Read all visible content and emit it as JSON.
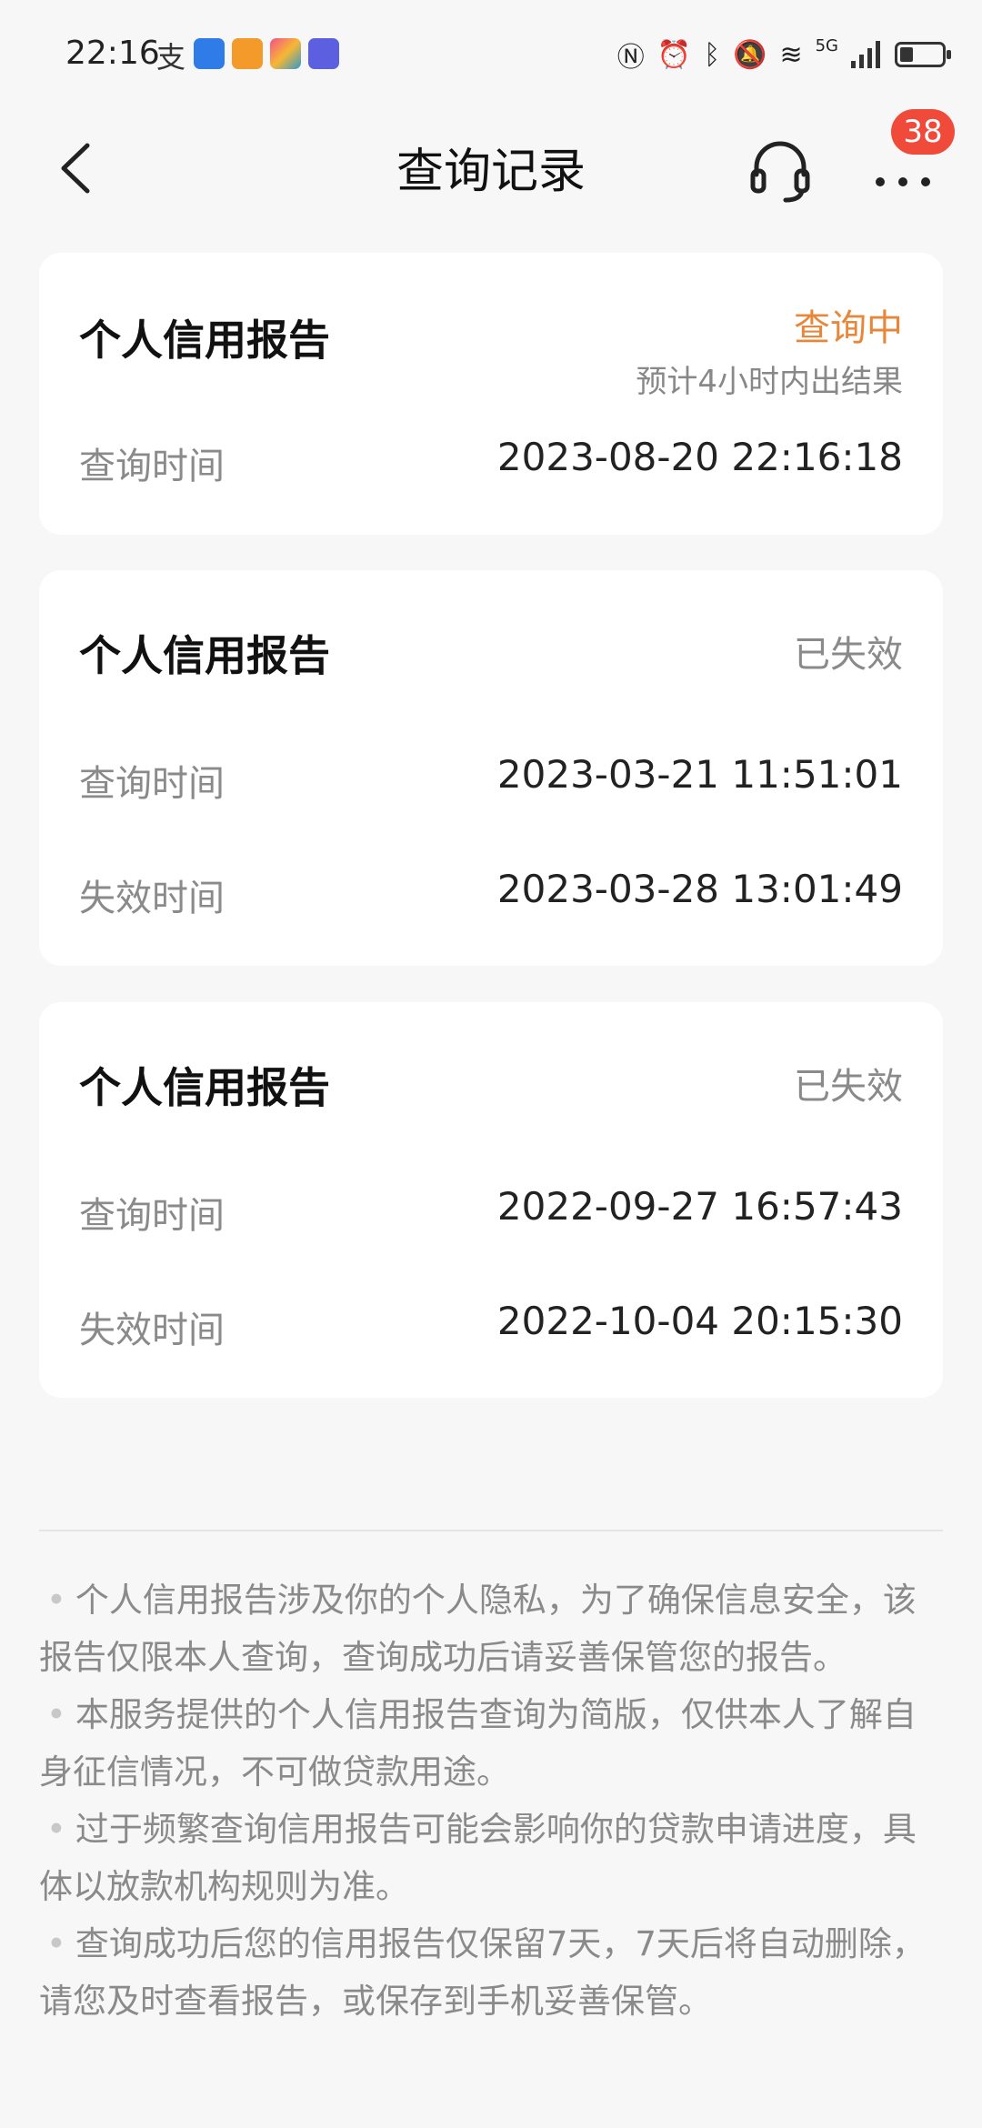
{
  "status_bar": {
    "time": "22:16",
    "network": "5G"
  },
  "nav": {
    "title": "查询记录",
    "badge_count": "38",
    "icons": [
      "back-icon",
      "headset-icon",
      "more-icon"
    ]
  },
  "records": [
    {
      "title": "个人信用报告",
      "status": "查询中",
      "status_note": "预计4小时内出结果",
      "query_label": "查询时间",
      "query_time": "2023-08-20 22:16:18"
    },
    {
      "title": "个人信用报告",
      "status": "已失效",
      "query_label": "查询时间",
      "query_time": "2023-03-21 11:51:01",
      "expire_label": "失效时间",
      "expire_time": "2023-03-28 13:01:49"
    },
    {
      "title": "个人信用报告",
      "status": "已失效",
      "query_label": "查询时间",
      "query_time": "2022-09-27 16:57:43",
      "expire_label": "失效时间",
      "expire_time": "2022-10-04 20:15:30"
    }
  ],
  "notes": [
    "个人信用报告涉及你的个人隐私，为了确保信息安全，该报告仅限本人查询，查询成功后请妥善保管您的报告。",
    "本服务提供的个人信用报告查询为简版，仅供本人了解自身征信情况，不可做贷款用途。",
    "过于频繁查询信用报告可能会影响你的贷款申请进度，具体以放款机构规则为准。",
    "查询成功后您的信用报告仅保留7天，7天后将自动删除，请您及时查看报告，或保存到手机妥善保管。"
  ],
  "colors": {
    "pending": "#e8873a",
    "badge": "#f04a3a",
    "muted": "#8a8a8a"
  }
}
